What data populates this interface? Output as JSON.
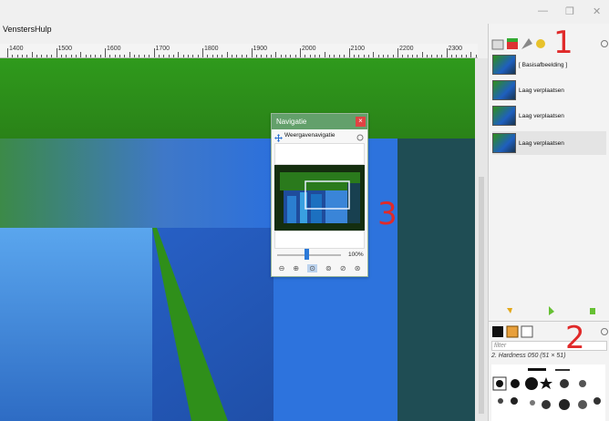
{
  "menu": {
    "item1": "Vensters",
    "item2": "Hulp"
  },
  "window": {
    "minimize": "—",
    "restore": "❐",
    "close": "✕"
  },
  "ruler": {
    "labels": [
      "1400",
      "1500",
      "1600",
      "1700",
      "1800",
      "1900",
      "2000",
      "2100",
      "2200",
      "2300"
    ]
  },
  "layers": {
    "items": [
      {
        "name": "[ Basisafbeelding ]"
      },
      {
        "name": "Laag verplaatsen"
      },
      {
        "name": "Laag verplaatsen"
      },
      {
        "name": "Laag verplaatsen"
      }
    ]
  },
  "brushes": {
    "filter_placeholder": "filter",
    "current": "2. Hardness 050 (51 × 51)"
  },
  "navigation": {
    "title": "Navigatie",
    "close": "×",
    "tab": "Weergavenavigatie",
    "zoom": "100%"
  },
  "annotations": {
    "one": "1",
    "two": "2",
    "three": "3"
  },
  "colors": {
    "dialog_header": "#63a06b",
    "annotation": "#e02a2a",
    "canvas_green": "#2f8f1a",
    "canvas_blue": "#2b6fd8"
  }
}
